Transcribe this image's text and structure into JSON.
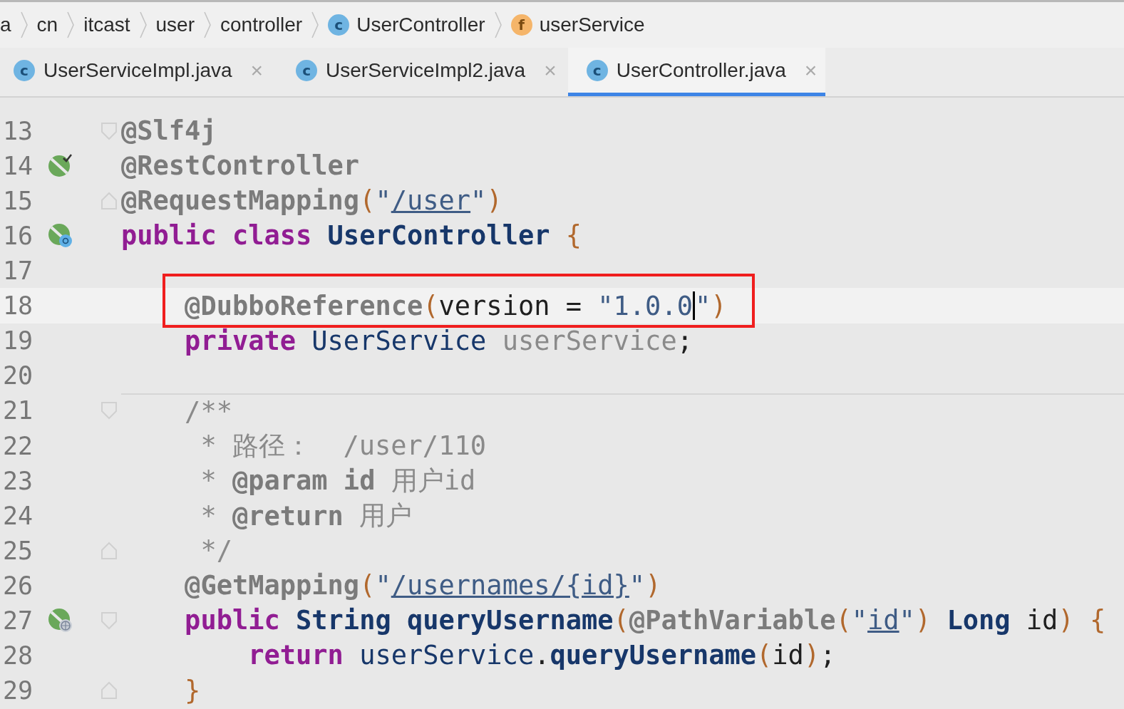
{
  "breadcrumbs": [
    {
      "label": "a"
    },
    {
      "label": "cn"
    },
    {
      "label": "itcast"
    },
    {
      "label": "user"
    },
    {
      "label": "controller"
    },
    {
      "label": "UserController",
      "icon": {
        "kind": "class",
        "letter": "c"
      }
    },
    {
      "label": "userService",
      "icon": {
        "kind": "field",
        "letter": "f"
      }
    }
  ],
  "tabs": [
    {
      "label": "UserServiceImpl.java",
      "icon": {
        "kind": "class",
        "letter": "c"
      },
      "close": "×",
      "selected": false
    },
    {
      "label": "UserServiceImpl2.java",
      "icon": {
        "kind": "class",
        "letter": "c"
      },
      "close": "×",
      "selected": false
    },
    {
      "label": "UserController.java",
      "icon": {
        "kind": "class",
        "letter": "c"
      },
      "close": "×",
      "selected": true
    }
  ],
  "lines": [
    {
      "number": "13",
      "fold": {
        "kind": "start"
      },
      "tokens": [
        {
          "kind": "annotation",
          "text": "@Slf4j"
        }
      ]
    },
    {
      "number": "14",
      "gutter": {
        "kind": "bean-check"
      },
      "tokens": [
        {
          "kind": "annotation",
          "text": "@RestController"
        }
      ]
    },
    {
      "number": "15",
      "fold": {
        "kind": "end"
      },
      "tokens": [
        {
          "kind": "annotation",
          "text": "@RequestMapping"
        },
        {
          "kind": "paren",
          "text": "("
        },
        {
          "kind": "string",
          "text": "\""
        },
        {
          "kind": "string",
          "text": "/user",
          "underline": true
        },
        {
          "kind": "string",
          "text": "\""
        },
        {
          "kind": "paren",
          "text": ")"
        }
      ]
    },
    {
      "number": "16",
      "gutter": {
        "kind": "bean-class"
      },
      "tokens": [
        {
          "kind": "keyword",
          "text": "public class "
        },
        {
          "kind": "class",
          "text": "UserController "
        },
        {
          "kind": "paren",
          "text": "{"
        }
      ]
    },
    {
      "number": "17"
    },
    {
      "number": "18",
      "current": true,
      "boxed": true,
      "tokens": [
        {
          "kind": "annotation",
          "text": "    @DubboReference"
        },
        {
          "kind": "paren",
          "text": "("
        },
        {
          "kind": "plain",
          "text": "version = "
        },
        {
          "kind": "string",
          "text": "\"1.0.0",
          "caret": true
        },
        {
          "kind": "string",
          "text": "\""
        },
        {
          "kind": "paren",
          "text": ")"
        }
      ]
    },
    {
      "number": "19",
      "tokens": [
        {
          "kind": "keyword",
          "text": "    private "
        },
        {
          "kind": "type",
          "text": "UserService "
        },
        {
          "kind": "unused",
          "text": "userService"
        },
        {
          "kind": "plain",
          "text": ";"
        }
      ]
    },
    {
      "number": "20"
    },
    {
      "number": "21",
      "fold": {
        "kind": "start"
      },
      "separator_above": true,
      "tokens": [
        {
          "kind": "comment",
          "text": "    /**"
        }
      ]
    },
    {
      "number": "22",
      "tokens": [
        {
          "kind": "comment",
          "text": "     * 路径：  /user/110"
        }
      ]
    },
    {
      "number": "23",
      "tokens": [
        {
          "kind": "comment",
          "text": "     * "
        },
        {
          "kind": "doctag",
          "text": "@param id"
        },
        {
          "kind": "comment",
          "text": " 用户id"
        }
      ]
    },
    {
      "number": "24",
      "tokens": [
        {
          "kind": "comment",
          "text": "     * "
        },
        {
          "kind": "doctag",
          "text": "@return"
        },
        {
          "kind": "comment",
          "text": " 用户"
        }
      ]
    },
    {
      "number": "25",
      "fold": {
        "kind": "end"
      },
      "tokens": [
        {
          "kind": "comment",
          "text": "     */"
        }
      ]
    },
    {
      "number": "26",
      "tokens": [
        {
          "kind": "annotation",
          "text": "    @GetMapping"
        },
        {
          "kind": "paren",
          "text": "("
        },
        {
          "kind": "string",
          "text": "\""
        },
        {
          "kind": "string",
          "text": "/usernames/{id}",
          "underline": true
        },
        {
          "kind": "string",
          "text": "\""
        },
        {
          "kind": "paren",
          "text": ")"
        }
      ]
    },
    {
      "number": "27",
      "gutter": {
        "kind": "bean-web"
      },
      "fold": {
        "kind": "start"
      },
      "tokens": [
        {
          "kind": "keyword",
          "text": "    public "
        },
        {
          "kind": "class",
          "text": "String "
        },
        {
          "kind": "method",
          "text": "queryUsername"
        },
        {
          "kind": "paren",
          "text": "("
        },
        {
          "kind": "annotation",
          "text": "@PathVariable"
        },
        {
          "kind": "paren",
          "text": "("
        },
        {
          "kind": "string",
          "text": "\""
        },
        {
          "kind": "string",
          "text": "id",
          "underline": true
        },
        {
          "kind": "string",
          "text": "\""
        },
        {
          "kind": "paren",
          "text": ") "
        },
        {
          "kind": "class",
          "text": "Long "
        },
        {
          "kind": "plain",
          "text": "id"
        },
        {
          "kind": "paren",
          "text": ") {"
        }
      ]
    },
    {
      "number": "28",
      "tokens": [
        {
          "kind": "keyword",
          "text": "        return "
        },
        {
          "kind": "field",
          "text": "userService"
        },
        {
          "kind": "plain",
          "text": "."
        },
        {
          "kind": "method",
          "text": "queryUsername"
        },
        {
          "kind": "paren",
          "text": "("
        },
        {
          "kind": "plain",
          "text": "id"
        },
        {
          "kind": "paren",
          "text": ")"
        },
        {
          "kind": "plain",
          "text": ";"
        }
      ]
    },
    {
      "number": "29",
      "fold": {
        "kind": "end"
      },
      "tokens": [
        {
          "kind": "paren",
          "text": "    }"
        }
      ]
    }
  ]
}
